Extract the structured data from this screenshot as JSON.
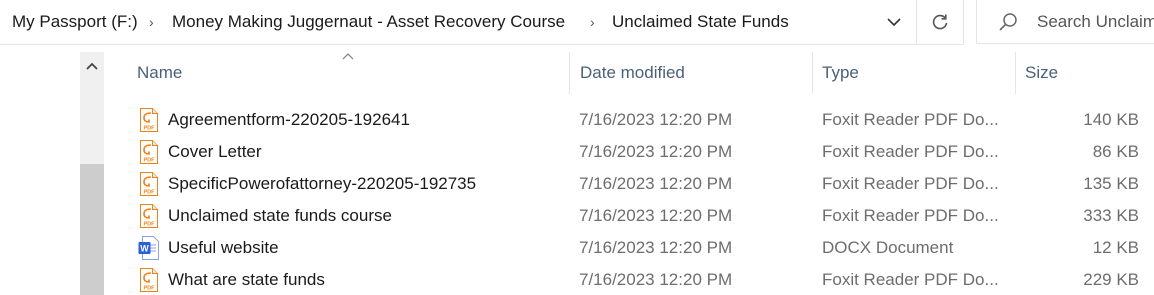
{
  "address_bar": {
    "crumbs": [
      "My Passport (F:)",
      "Money Making Juggernaut - Asset Recovery Course",
      "Unclaimed State Funds"
    ],
    "separator": "›"
  },
  "search": {
    "placeholder": "Search Unclaim"
  },
  "columns": {
    "name": "Name",
    "date": "Date modified",
    "type": "Type",
    "size": "Size"
  },
  "files": [
    {
      "name": "Agreementform-220205-192641",
      "date": "7/16/2023 12:20 PM",
      "type": "Foxit Reader PDF Do...",
      "size": "140 KB",
      "icon": "pdf-file-icon"
    },
    {
      "name": "Cover Letter",
      "date": "7/16/2023 12:20 PM",
      "type": "Foxit Reader PDF Do...",
      "size": "86 KB",
      "icon": "pdf-file-icon"
    },
    {
      "name": "SpecificPowerofattorney-220205-192735",
      "date": "7/16/2023 12:20 PM",
      "type": "Foxit Reader PDF Do...",
      "size": "135 KB",
      "icon": "pdf-file-icon"
    },
    {
      "name": "Unclaimed state funds course",
      "date": "7/16/2023 12:20 PM",
      "type": "Foxit Reader PDF Do...",
      "size": "333 KB",
      "icon": "pdf-file-icon"
    },
    {
      "name": "Useful website",
      "date": "7/16/2023 12:20 PM",
      "type": "DOCX Document",
      "size": "12 KB",
      "icon": "word-file-icon"
    },
    {
      "name": "What are state funds",
      "date": "7/16/2023 12:20 PM",
      "type": "Foxit Reader PDF Do...",
      "size": "229 KB",
      "icon": "pdf-file-icon"
    }
  ],
  "colors": {
    "pdf_icon": "#e8841a",
    "word_icon": "#2b5fd9",
    "header_text": "#4c607a"
  }
}
